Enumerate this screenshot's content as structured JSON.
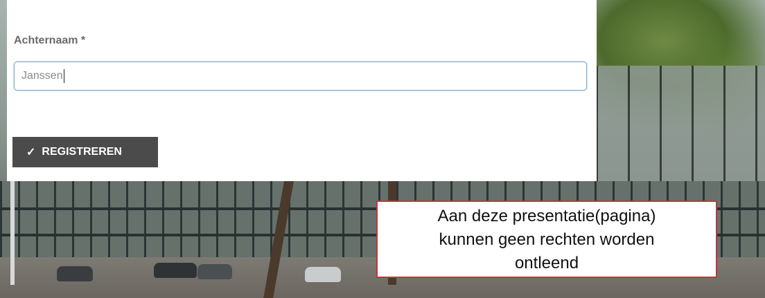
{
  "form": {
    "lastname_label": "Achternaam *",
    "lastname_value": "Janssen",
    "submit": {
      "check_glyph": "✓",
      "label": "REGISTREREN"
    }
  },
  "disclaimer": {
    "line1": "Aan deze presentatie(pagina)",
    "line2": "kunnen geen rechten worden",
    "line3": "ontleend"
  },
  "colors": {
    "button_bg": "#4b4b4b",
    "disclaimer_border": "#c8323a",
    "input_border": "#7fa7c9"
  },
  "icons": {
    "submit_icon": "checkmark-icon"
  }
}
